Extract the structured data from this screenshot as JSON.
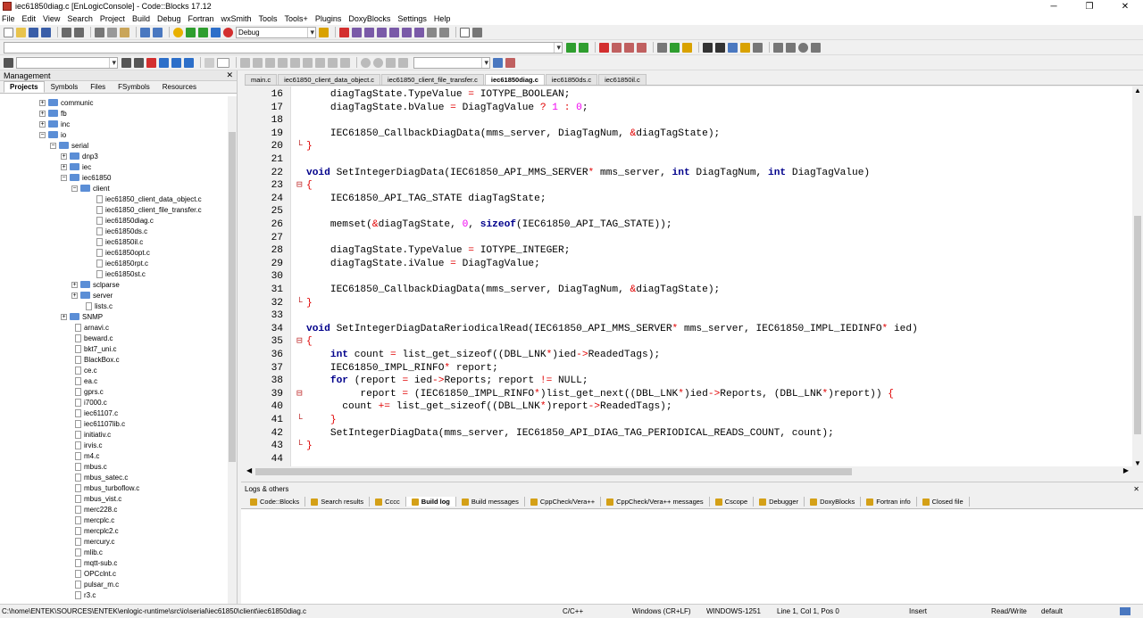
{
  "window": {
    "title": "iec61850diag.c [EnLogicConsole] - Code::Blocks 17.12"
  },
  "menu": [
    "File",
    "Edit",
    "View",
    "Search",
    "Project",
    "Build",
    "Debug",
    "Fortran",
    "wxSmith",
    "Tools",
    "Tools+",
    "Plugins",
    "DoxyBlocks",
    "Settings",
    "Help"
  ],
  "toolbar": {
    "build_target": "Debug"
  },
  "management": {
    "title": "Management",
    "tabs": [
      "Projects",
      "Symbols",
      "Files",
      "FSymbols",
      "Resources"
    ],
    "tree": [
      {
        "label": "communic",
        "type": "folder",
        "depth": 0
      },
      {
        "label": "fb",
        "type": "folder",
        "depth": 0
      },
      {
        "label": "inc",
        "type": "folder",
        "depth": 0
      },
      {
        "label": "io",
        "type": "folder",
        "depth": 0,
        "open": true
      },
      {
        "label": "serial",
        "type": "folder",
        "depth": 1,
        "open": true
      },
      {
        "label": "dnp3",
        "type": "folder",
        "depth": 2
      },
      {
        "label": "iec",
        "type": "folder",
        "depth": 2
      },
      {
        "label": "iec61850",
        "type": "folder",
        "depth": 2,
        "open": true
      },
      {
        "label": "client",
        "type": "folder",
        "depth": 3,
        "open": true
      },
      {
        "label": "iec61850_client_data_object.c",
        "type": "file",
        "depth": 4
      },
      {
        "label": "iec61850_client_file_transfer.c",
        "type": "file",
        "depth": 4
      },
      {
        "label": "iec61850diag.c",
        "type": "file",
        "depth": 4
      },
      {
        "label": "iec61850ds.c",
        "type": "file",
        "depth": 4
      },
      {
        "label": "iec61850il.c",
        "type": "file",
        "depth": 4
      },
      {
        "label": "iec61850opt.c",
        "type": "file",
        "depth": 4
      },
      {
        "label": "iec61850rpt.c",
        "type": "file",
        "depth": 4
      },
      {
        "label": "iec61850st.c",
        "type": "file",
        "depth": 4
      },
      {
        "label": "sclparse",
        "type": "folder",
        "depth": 3
      },
      {
        "label": "server",
        "type": "folder",
        "depth": 3
      },
      {
        "label": "lists.c",
        "type": "file",
        "depth": 3
      },
      {
        "label": "SNMP",
        "type": "folder",
        "depth": 2
      },
      {
        "label": "arnavi.c",
        "type": "file",
        "depth": 2
      },
      {
        "label": "beward.c",
        "type": "file",
        "depth": 2
      },
      {
        "label": "bkt7_uni.c",
        "type": "file",
        "depth": 2
      },
      {
        "label": "BlackBox.c",
        "type": "file",
        "depth": 2
      },
      {
        "label": "ce.c",
        "type": "file",
        "depth": 2
      },
      {
        "label": "ea.c",
        "type": "file",
        "depth": 2
      },
      {
        "label": "gprs.c",
        "type": "file",
        "depth": 2
      },
      {
        "label": "i7000.c",
        "type": "file",
        "depth": 2
      },
      {
        "label": "iec61107.c",
        "type": "file",
        "depth": 2
      },
      {
        "label": "iec61107lib.c",
        "type": "file",
        "depth": 2
      },
      {
        "label": "initiativ.c",
        "type": "file",
        "depth": 2
      },
      {
        "label": "irvis.c",
        "type": "file",
        "depth": 2
      },
      {
        "label": "m4.c",
        "type": "file",
        "depth": 2
      },
      {
        "label": "mbus.c",
        "type": "file",
        "depth": 2
      },
      {
        "label": "mbus_satec.c",
        "type": "file",
        "depth": 2
      },
      {
        "label": "mbus_turboflow.c",
        "type": "file",
        "depth": 2
      },
      {
        "label": "mbus_vist.c",
        "type": "file",
        "depth": 2
      },
      {
        "label": "merc228.c",
        "type": "file",
        "depth": 2
      },
      {
        "label": "mercplc.c",
        "type": "file",
        "depth": 2
      },
      {
        "label": "mercplc2.c",
        "type": "file",
        "depth": 2
      },
      {
        "label": "mercury.c",
        "type": "file",
        "depth": 2
      },
      {
        "label": "mlib.c",
        "type": "file",
        "depth": 2
      },
      {
        "label": "mqtt-sub.c",
        "type": "file",
        "depth": 2
      },
      {
        "label": "OPCclnt.c",
        "type": "file",
        "depth": 2
      },
      {
        "label": "pulsar_m.c",
        "type": "file",
        "depth": 2
      },
      {
        "label": "r3.c",
        "type": "file",
        "depth": 2
      }
    ]
  },
  "editor": {
    "tabs": [
      "main.c",
      "iec61850_client_data_object.c",
      "iec61850_client_file_transfer.c",
      "iec61850diag.c",
      "iec61850ds.c",
      "iec61850il.c"
    ],
    "active_tab": "iec61850diag.c",
    "lines": [
      {
        "n": "16",
        "f": "",
        "html": "    diagTagState.TypeValue <span class=\"op\">=</span> IOTYPE_BOOLEAN;"
      },
      {
        "n": "17",
        "f": "",
        "html": "    diagTagState.bValue <span class=\"op\">=</span> DiagTagValue <span class=\"op\">?</span> <span class=\"num\">1</span> <span class=\"op\">:</span> <span class=\"num\">0</span>;"
      },
      {
        "n": "18",
        "f": "",
        "html": ""
      },
      {
        "n": "19",
        "f": "",
        "html": "    IEC61850_CallbackDiagData(mms_server, DiagTagNum, <span class=\"op\">&amp;</span>diagTagState);"
      },
      {
        "n": "20",
        "f": "-",
        "html": "<span class=\"op\">}</span>"
      },
      {
        "n": "21",
        "f": "",
        "html": ""
      },
      {
        "n": "22",
        "f": "",
        "html": "<span class=\"kw\">void</span> SetIntegerDiagData(IEC61850_API_MMS_SERVER<span class=\"op\">*</span> mms_server, <span class=\"kw\">int</span> DiagTagNum, <span class=\"kw\">int</span> DiagTagValue)"
      },
      {
        "n": "23",
        "f": "⊟",
        "html": "<span class=\"op\">{</span>"
      },
      {
        "n": "24",
        "f": "",
        "html": "    IEC61850_API_TAG_STATE diagTagState;"
      },
      {
        "n": "25",
        "f": "",
        "html": ""
      },
      {
        "n": "26",
        "f": "",
        "html": "    memset(<span class=\"op\">&amp;</span>diagTagState, <span class=\"num\">0</span>, <span class=\"kw\">sizeof</span>(IEC61850_API_TAG_STATE));"
      },
      {
        "n": "27",
        "f": "",
        "html": ""
      },
      {
        "n": "28",
        "f": "",
        "html": "    diagTagState.TypeValue <span class=\"op\">=</span> IOTYPE_INTEGER;"
      },
      {
        "n": "29",
        "f": "",
        "html": "    diagTagState.iValue <span class=\"op\">=</span> DiagTagValue;"
      },
      {
        "n": "30",
        "f": "",
        "html": ""
      },
      {
        "n": "31",
        "f": "",
        "html": "    IEC61850_CallbackDiagData(mms_server, DiagTagNum, <span class=\"op\">&amp;</span>diagTagState);"
      },
      {
        "n": "32",
        "f": "-",
        "html": "<span class=\"op\">}</span>"
      },
      {
        "n": "33",
        "f": "",
        "html": ""
      },
      {
        "n": "34",
        "f": "",
        "html": "<span class=\"kw\">void</span> SetIntegerDiagDataReriodicalRead(IEC61850_API_MMS_SERVER<span class=\"op\">*</span> mms_server, IEC61850_IMPL_IEDINFO<span class=\"op\">*</span> ied)"
      },
      {
        "n": "35",
        "f": "⊟",
        "html": "<span class=\"op\">{</span>"
      },
      {
        "n": "36",
        "f": "",
        "html": "    <span class=\"kw\">int</span> count <span class=\"op\">=</span> list_get_sizeof((DBL_LNK<span class=\"op\">*</span>)ied<span class=\"op\">-&gt;</span>ReadedTags);"
      },
      {
        "n": "37",
        "f": "",
        "html": "    IEC61850_IMPL_RINFO<span class=\"op\">*</span> report;"
      },
      {
        "n": "38",
        "f": "",
        "html": "    <span class=\"kw\">for</span> (report <span class=\"op\">=</span> ied<span class=\"op\">-&gt;</span>Reports; report <span class=\"op\">!=</span> NULL;"
      },
      {
        "n": "39",
        "f": "⊟",
        "html": "         report <span class=\"op\">=</span> (IEC61850_IMPL_RINFO<span class=\"op\">*</span>)list_get_next((DBL_LNK<span class=\"op\">*</span>)ied<span class=\"op\">-&gt;</span>Reports, (DBL_LNK<span class=\"op\">*</span>)report)) <span class=\"op\">{</span>"
      },
      {
        "n": "40",
        "f": "",
        "html": "      count <span class=\"op\">+=</span> list_get_sizeof((DBL_LNK<span class=\"op\">*</span>)report<span class=\"op\">-&gt;</span>ReadedTags);"
      },
      {
        "n": "41",
        "f": "-",
        "html": "    <span class=\"op\">}</span>"
      },
      {
        "n": "42",
        "f": "",
        "html": "    SetIntegerDiagData(mms_server, IEC61850_API_DIAG_TAG_PERIODICAL_READS_COUNT, count);"
      },
      {
        "n": "43",
        "f": "-",
        "html": "<span class=\"op\">}</span>"
      },
      {
        "n": "44",
        "f": "",
        "html": ""
      }
    ]
  },
  "logs": {
    "title": "Logs & others",
    "tabs": [
      "Code::Blocks",
      "Search results",
      "Cccc",
      "Build log",
      "Build messages",
      "CppCheck/Vera++",
      "CppCheck/Vera++ messages",
      "Cscope",
      "Debugger",
      "DoxyBlocks",
      "Fortran info",
      "Closed file"
    ],
    "active_tab": "Build log"
  },
  "status": {
    "path": "C:\\home\\ENTEK\\SOURCES\\ENTEK\\enlogic-runtime\\src\\io\\serial\\iec61850\\client\\iec61850diag.c",
    "lang": "C/C++",
    "eol": "Windows (CR+LF)",
    "encoding": "WINDOWS-1251",
    "position": "Line 1, Col 1, Pos 0",
    "mode": "Insert",
    "access": "Read/Write",
    "theme": "default"
  },
  "colors": {
    "keyword": "#00008b",
    "number": "#f000f0",
    "operator": "#e00000",
    "folder": "#5b8ed6"
  }
}
